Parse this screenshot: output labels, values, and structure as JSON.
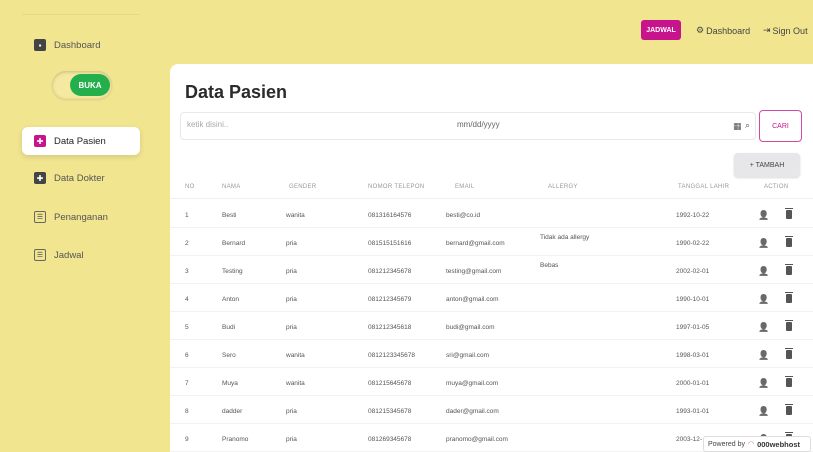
{
  "sidebar": {
    "items": [
      {
        "label": "Dashboard",
        "icon": "dashboard-icon"
      },
      {
        "label": "Data Pasien",
        "icon": "patient-icon"
      },
      {
        "label": "Data Dokter",
        "icon": "doctor-icon"
      },
      {
        "label": "Penanganan",
        "icon": "list-icon"
      },
      {
        "label": "Jadwal",
        "icon": "list-icon"
      }
    ],
    "toggle_label": "BUKA"
  },
  "topbar": {
    "jadwal_label": "JADWAL",
    "dashboard_label": "Dashboard",
    "signout_label": "Sign Out"
  },
  "main": {
    "title": "Data Pasien",
    "search_placeholder": "ketik disini..",
    "date_placeholder": "mm/dd/yyyy",
    "cari_label": "CARI",
    "tambah_label": "+ TAMBAH"
  },
  "table": {
    "headers": [
      "NO",
      "NAMA",
      "GENDER",
      "NOMOR TELEPON",
      "EMAIL",
      "ALLERGY",
      "TANGGAL LAHIR",
      "ACTION"
    ],
    "rows": [
      [
        "1",
        "Besti",
        "wanita",
        "081316164576",
        "besti@co.id",
        "",
        "1992-10-22"
      ],
      [
        "2",
        "Bernard",
        "pria",
        "081515151616",
        "bernard@gmail.com",
        "Tidak ada allergy",
        "1990-02-22"
      ],
      [
        "3",
        "Testing",
        "pria",
        "081212345678",
        "testing@gmail.com",
        "Bebas",
        "2002-02-01"
      ],
      [
        "4",
        "Anton",
        "pria",
        "081212345679",
        "anton@gmail.com",
        "",
        "1990-10-01"
      ],
      [
        "5",
        "Budi",
        "pria",
        "081212345618",
        "budi@gmail.com",
        "",
        "1997-01-05"
      ],
      [
        "6",
        "Sero",
        "wanita",
        "0812123345678",
        "sri@gmail.com",
        "",
        "1998-03-01"
      ],
      [
        "7",
        "Muya",
        "wanita",
        "081215645678",
        "muya@gmail.com",
        "",
        "2000-01-01"
      ],
      [
        "8",
        "dadder",
        "pria",
        "081215345678",
        "dader@gmail.com",
        "",
        "1993-01-01"
      ],
      [
        "9",
        "Pranomo",
        "pria",
        "081269345678",
        "pranomo@gmail.com",
        "",
        "2003-12-"
      ]
    ]
  },
  "footer": {
    "powered_by": "Powered by",
    "brand": "000webhost"
  },
  "colors": {
    "background": "#f1e58f",
    "accent": "#c8148c",
    "toggle": "#23b04c"
  }
}
